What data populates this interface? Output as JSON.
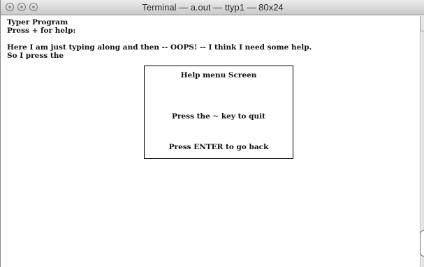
{
  "window": {
    "title": "Terminal — a.out — ttyp1 — 80x24",
    "buttons": [
      "close",
      "minimize",
      "zoom"
    ]
  },
  "terminal": {
    "lines": [
      "Typer Program",
      "Press + for help:",
      "",
      "Here I am just typing along and then -- OOPS! -- I think I need some help.",
      "So I press the"
    ]
  },
  "help_dialog": {
    "title": "Help menu Screen",
    "quit_text": "Press the ~ key to quit",
    "back_text": "Press ENTER to go back"
  }
}
